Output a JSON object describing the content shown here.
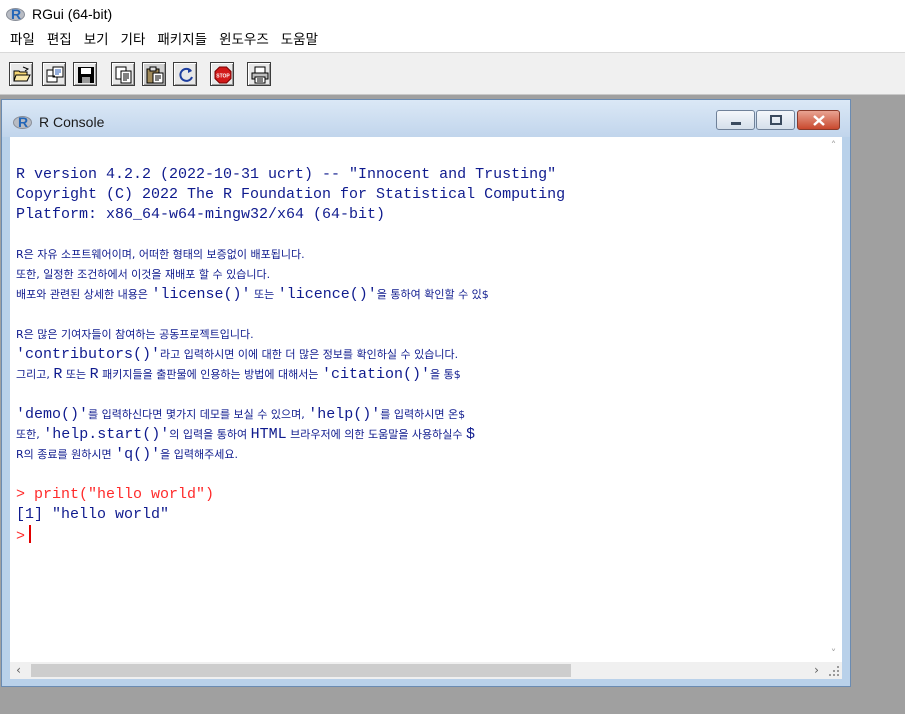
{
  "app": {
    "title": "RGui (64-bit)"
  },
  "menu": [
    "파일",
    "편집",
    "보기",
    "기타",
    "패키지들",
    "윈도우즈",
    "도움말"
  ],
  "toolbar": {
    "buttons": [
      "open-script",
      "load-workspace",
      "save-workspace",
      "copy",
      "paste",
      "copy-paste",
      "stop",
      "print"
    ]
  },
  "console": {
    "title": "R Console",
    "lines": {
      "l1": "R version 4.2.2 (2022-10-31 ucrt) -- \"Innocent and Trusting\"",
      "l2": "Copyright (C) 2022 The R Foundation for Statistical Computing",
      "l3": "Platform: x86_64-w64-mingw32/x64 (64-bit)",
      "l4": "R은 자유 소프트웨어이며, 어떠한 형태의 보증없이 배포됩니다.",
      "l5": "또한, 일정한 조건하에서 이것을 재배포 할 수 있습니다.",
      "l6a": "배포와 관련된 상세한 내용은 ",
      "l6b": "'license()'",
      "l6c": " 또는 ",
      "l6d": "'licence()'",
      "l6e": "을 통하여 확인할 수 있$",
      "l7": "R은 많은 기여자들이 참여하는 공동프로젝트입니다.",
      "l8a": "'contributors()'",
      "l8b": "라고 입력하시면 이에 대한 더 많은 정보를 확인하실 수 있습니다.",
      "l9a": "그리고, ",
      "l9b": "R",
      "l9c": " 또는 ",
      "l9d": "R",
      "l9e": " 패키지들을 출판물에 인용하는 방법에 대해서는 ",
      "l9f": "'citation()'",
      "l9g": "을 통$",
      "l10a": "'demo()'",
      "l10b": "를 입력하신다면 몇가지 데모를 보실 수 있으며, ",
      "l10c": "'help()'",
      "l10d": "를 입력하시면 온$",
      "l11a": "또한, ",
      "l11b": "'help.start()'",
      "l11c": "의 입력을 통하여 ",
      "l11d": "HTML",
      "l11e": " 브라우저에 의한 도움말을 사용하실수 ",
      "l11f": "$",
      "l12a": "R의 종료를 원하시면 ",
      "l12b": "'q()'",
      "l12c": "을 입력해주세요.",
      "input": "> print(\"hello world\")",
      "output": "[1] \"hello world\"",
      "prompt": ">"
    }
  }
}
